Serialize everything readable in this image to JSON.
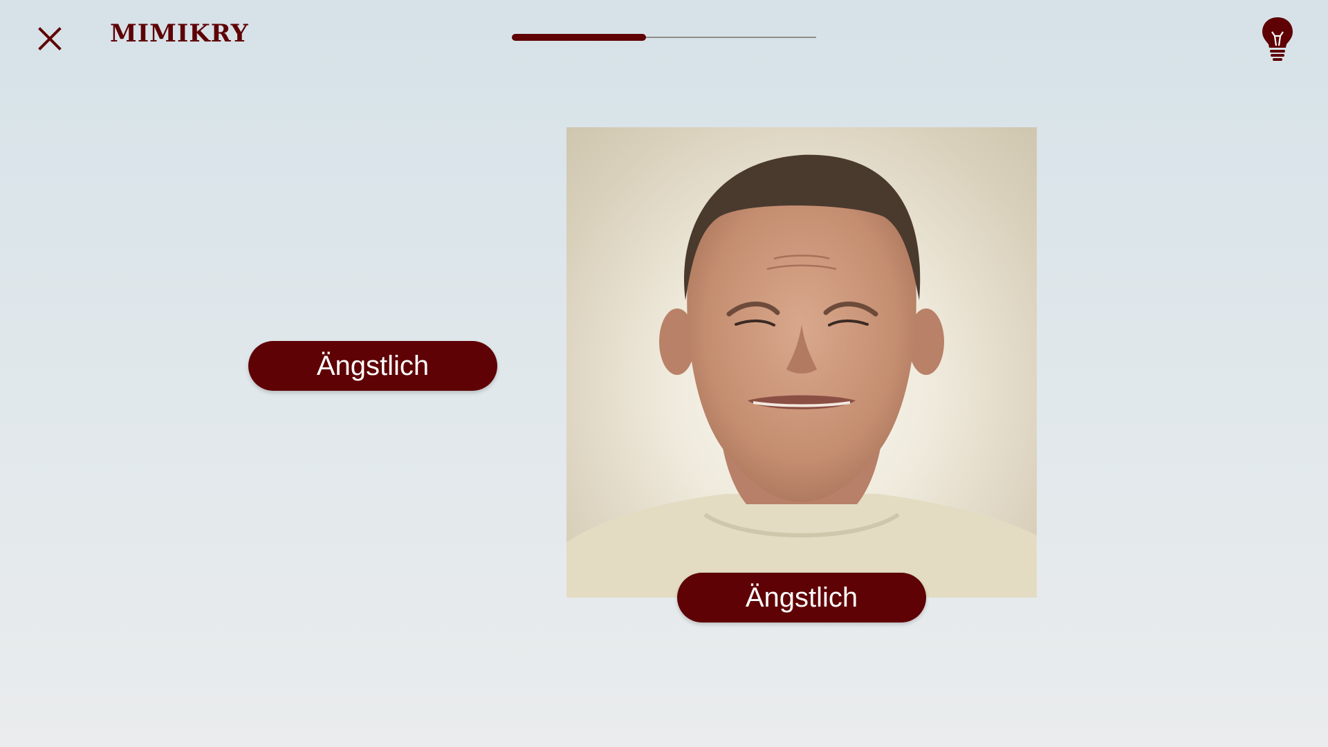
{
  "header": {
    "close_icon": "close-icon",
    "title": "MIMIKRY",
    "hint_icon": "lightbulb-icon"
  },
  "progress": {
    "fraction": 0.44
  },
  "colors": {
    "accent": "#5e0205",
    "button_text": "#ffffff",
    "background": "#dfe7eb"
  },
  "options": {
    "left_label": "Ängstlich",
    "bottom_label": "Ängstlich"
  }
}
